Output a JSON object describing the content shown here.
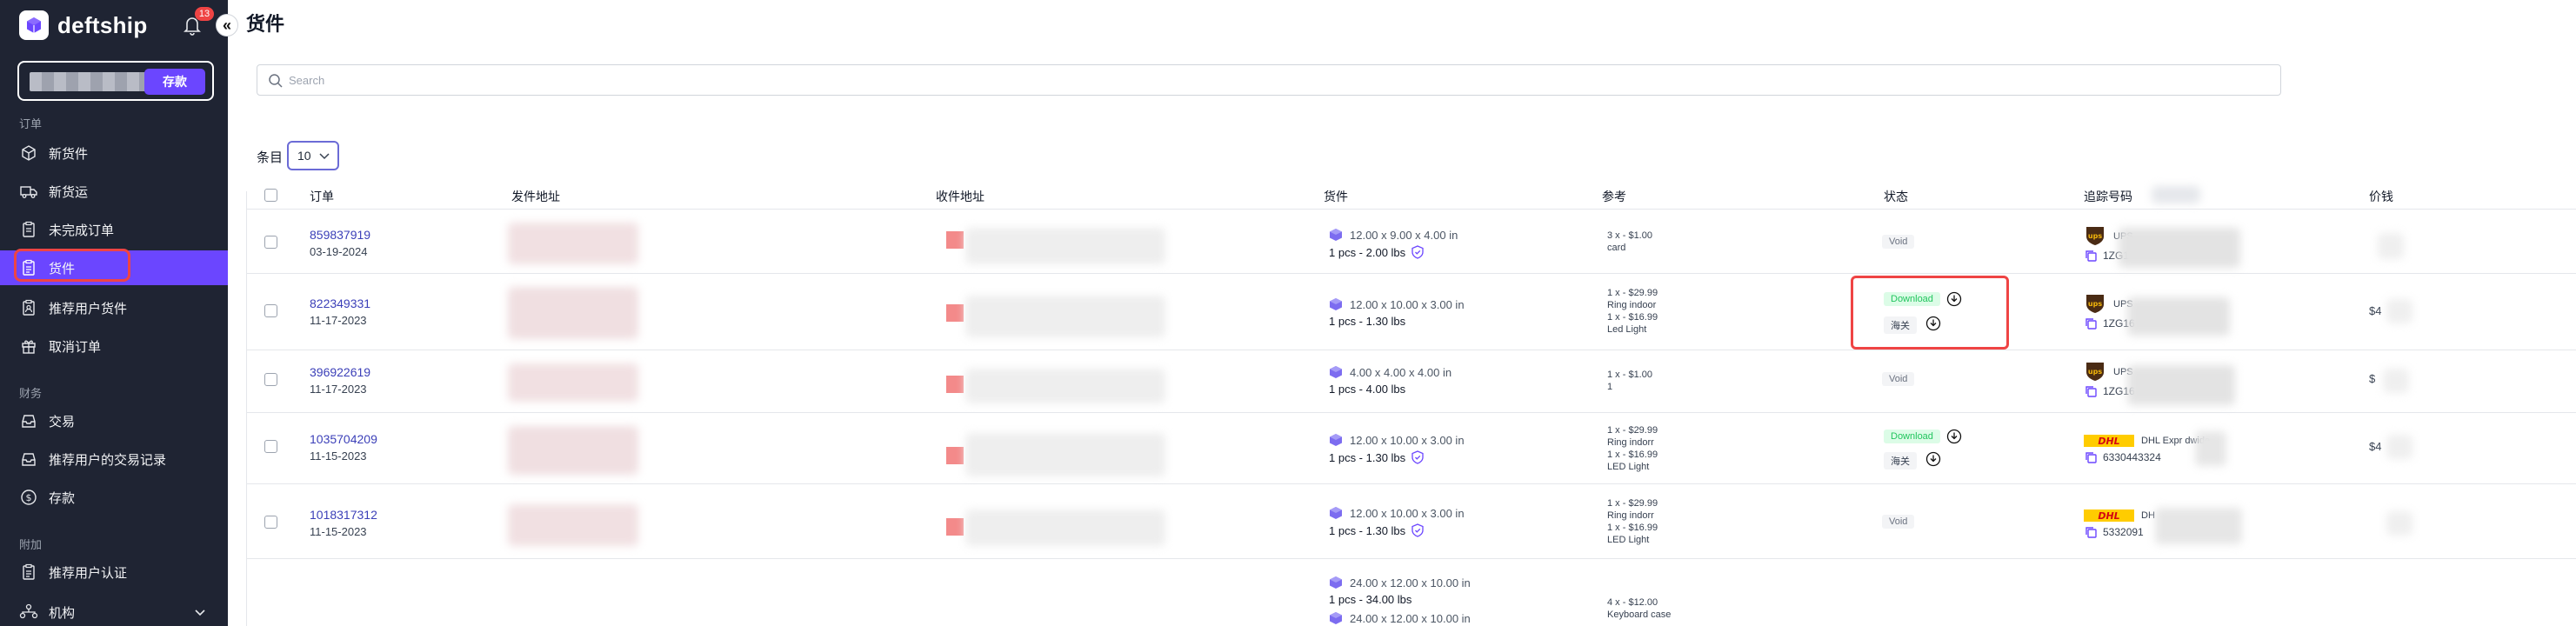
{
  "sidebar": {
    "brand": "deftship",
    "notification_count": "13",
    "collapse_glyph": "«",
    "deposit_label": "存款",
    "sections": {
      "orders": "订单",
      "finance": "财务",
      "extras": "附加"
    },
    "items": [
      {
        "label": "新货件",
        "icon": "box-icon"
      },
      {
        "label": "新货运",
        "icon": "truck-icon"
      },
      {
        "label": "未完成订单",
        "icon": "clipboard-icon"
      },
      {
        "label": "货件",
        "icon": "clipboard-list-icon",
        "active": true
      },
      {
        "label": "推荐用户货件",
        "icon": "clipboard-user-icon"
      },
      {
        "label": "取消订单",
        "icon": "gift-icon"
      },
      {
        "label": "交易",
        "icon": "inbox-icon"
      },
      {
        "label": "推荐用户的交易记录",
        "icon": "inbox-user-icon"
      },
      {
        "label": "存款",
        "icon": "dollar-icon"
      },
      {
        "label": "推荐用户认证",
        "icon": "clipboard-check-icon"
      },
      {
        "label": "机构",
        "icon": "org-icon"
      }
    ]
  },
  "main": {
    "title": "货件",
    "search_placeholder": "Search",
    "entries_label": "条目",
    "entries_value": "10",
    "columns": [
      "订单",
      "发件地址",
      "收件地址",
      "货件",
      "参考",
      "状态",
      "追踪号码",
      "价钱"
    ],
    "rows": [
      {
        "order": "859837919",
        "date": "03-19-2024",
        "dims": "12.00 x 9.00 x 4.00 in",
        "weight": "1 pcs - 2.00 lbs",
        "insured": true,
        "ref": [
          "3 x - $1.00",
          "card"
        ],
        "status": [
          "Void"
        ],
        "carrier": "UPS",
        "carrier_text": "UPS",
        "tracking": "1ZG1",
        "price": ""
      },
      {
        "order": "822349331",
        "date": "11-17-2023",
        "dims": "12.00 x 10.00 x 3.00 in",
        "weight": "1 pcs - 1.30 lbs",
        "insured": false,
        "ref": [
          "1 x - $29.99",
          "Ring indoor",
          "1 x - $16.99",
          "Led Light"
        ],
        "status": [
          "Download",
          "海关"
        ],
        "carrier": "UPS",
        "carrier_text": "UPS",
        "tracking": "1ZG16",
        "price": "$4"
      },
      {
        "order": "396922619",
        "date": "11-17-2023",
        "dims": "4.00 x 4.00 x 4.00 in",
        "weight": "1 pcs - 4.00 lbs",
        "insured": false,
        "ref": [
          "1 x - $1.00",
          "1"
        ],
        "status": [
          "Void"
        ],
        "carrier": "UPS",
        "carrier_text": "UPS",
        "tracking": "1ZG16",
        "price": "$"
      },
      {
        "order": "1035704209",
        "date": "11-15-2023",
        "dims": "12.00 x 10.00 x 3.00 in",
        "weight": "1 pcs - 1.30 lbs",
        "insured": true,
        "ref": [
          "1 x - $29.99",
          "Ring indorr",
          "1 x - $16.99",
          "LED Light"
        ],
        "status": [
          "Download",
          "海关"
        ],
        "carrier": "DHL",
        "carrier_text": "DHL Expr            dwide",
        "tracking": "6330443324",
        "price": "$4"
      },
      {
        "order": "1018317312",
        "date": "11-15-2023",
        "dims": "12.00 x 10.00 x 3.00 in",
        "weight": "1 pcs - 1.30 lbs",
        "insured": true,
        "ref": [
          "1 x - $29.99",
          "Ring indorr",
          "1 x - $16.99",
          "LED Light"
        ],
        "status": [
          "Void"
        ],
        "carrier": "DHL",
        "carrier_text": "DH",
        "tracking": "5332091",
        "price": ""
      },
      {
        "order": "",
        "date": "",
        "dims": "24.00 x 12.00 x 10.00 in",
        "weight": "1 pcs - 34.00 lbs",
        "dims2": "24.00 x 12.00 x 10.00 in",
        "ref": [
          "4 x - $12.00",
          "Keyboard case"
        ],
        "status": []
      }
    ]
  },
  "colors": {
    "sidebar_bg": "#1f2433",
    "accent": "#6b46ff",
    "link": "#3b3fb8",
    "highlight": "#ef4444",
    "download_green": "#22c55e"
  }
}
